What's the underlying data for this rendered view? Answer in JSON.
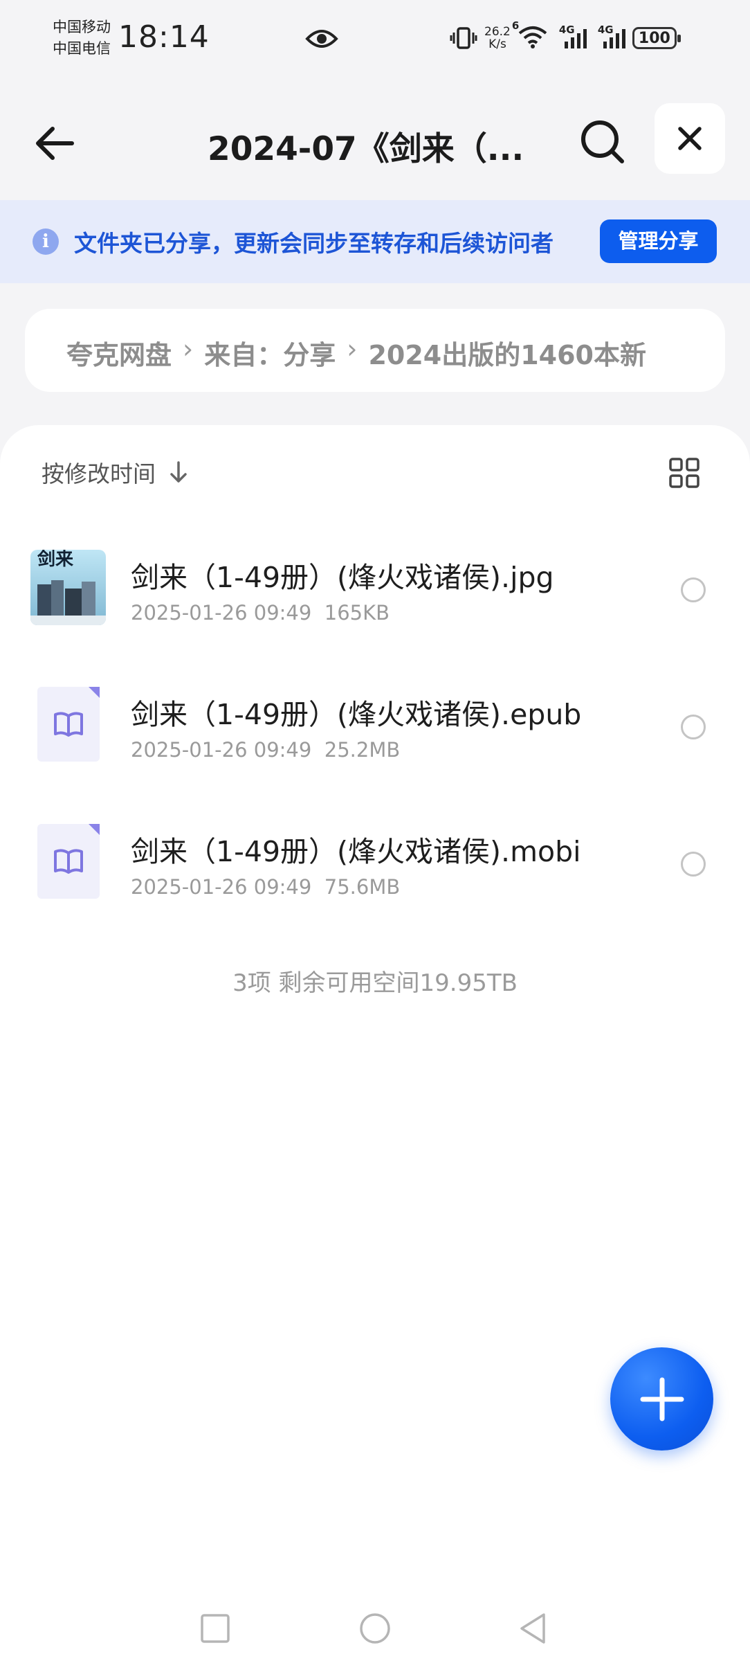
{
  "status_bar": {
    "carrier_1": "中国移动",
    "carrier_2": "中国电信",
    "time": "18:14",
    "net_speed_value": "26.2",
    "net_speed_unit": "K/s",
    "wifi_label": "6",
    "signal_1_label": "4G",
    "signal_2_label": "4G",
    "battery": "100"
  },
  "header": {
    "title": "2024-07《剑来（..."
  },
  "share_banner": {
    "message": "文件夹已分享，更新会同步至转存和后续访问者",
    "manage_label": "管理分享"
  },
  "breadcrumb": {
    "items": [
      "夸克网盘",
      "来自：分享",
      "2024出版的1460本新"
    ]
  },
  "toolbar": {
    "sort_label": "按修改时间"
  },
  "files": [
    {
      "name": "剑来（1-49册）(烽火戏诸侯).jpg",
      "date": "2025-01-26 09:49",
      "size": "165KB",
      "type": "image"
    },
    {
      "name": "剑来（1-49册）(烽火戏诸侯).epub",
      "date": "2025-01-26 09:49",
      "size": "25.2MB",
      "type": "ebook"
    },
    {
      "name": "剑来（1-49册）(烽火戏诸侯).mobi",
      "date": "2025-01-26 09:49",
      "size": "75.6MB",
      "type": "ebook"
    }
  ],
  "footer": {
    "summary": "3项 剩余可用空间19.95TB"
  },
  "colors": {
    "accent": "#0d5dee",
    "banner_bg": "#e6ebfb",
    "banner_text": "#1d55d6",
    "page_bg": "#f4f4f6"
  },
  "icons": {
    "back": "arrow-left-icon",
    "search": "search-icon",
    "close": "close-icon",
    "info": "info-icon",
    "sort": "arrow-down-icon",
    "grid": "grid-view-icon",
    "ebook": "book-icon",
    "fab": "plus-icon"
  }
}
